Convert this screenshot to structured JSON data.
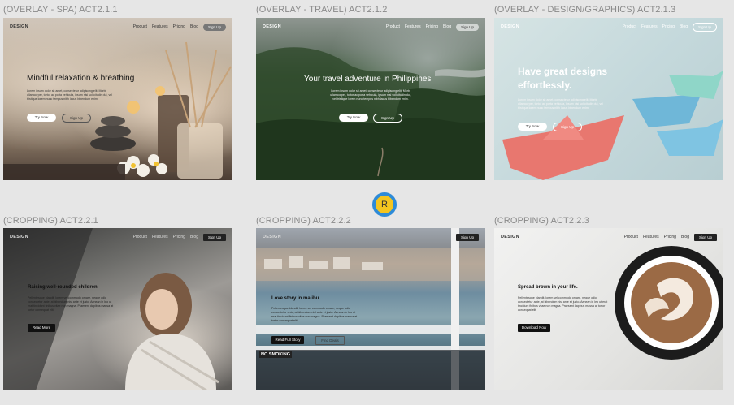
{
  "frames": [
    {
      "label": "(OVERLAY - SPA) ACT2.1.1",
      "logo": "DESIGN",
      "nav": [
        "Product",
        "Features",
        "Pricing",
        "Blog"
      ],
      "nav_button": "Sign Up",
      "title": "Mindful relaxation & breathing",
      "body": "Lorem ipsum dolor sit amet, consectetur adipiscing elit. Morbi ullamcorper, tortor ac porta vehicula, ipsum nisi sollicitudin dui, vel tristique lorem nunc tempus nibh lacus bibendum enim.",
      "primary_button": "Try Now",
      "secondary_button": "Sign Up"
    },
    {
      "label": "(OVERLAY - TRAVEL) ACT2.1.2",
      "logo": "DESIGN",
      "nav": [
        "Product",
        "Features",
        "Pricing",
        "Blog"
      ],
      "nav_button": "Sign Up",
      "title": "Your travel adventure in Philippines",
      "body": "Lorem ipsum dolor sit amet, consectetur adipiscing elit. Morbi ullamcorper, tortor ac porta vehicula, ipsum nisi sollicitudin dui, vel tristique lorem nunc tempus nibh lacus bibendum enim.",
      "primary_button": "Try Now",
      "secondary_button": "Sign Up"
    },
    {
      "label": "(OVERLAY - DESIGN/GRAPHICS) ACT2.1.3",
      "logo": "DESIGN",
      "nav": [
        "Product",
        "Features",
        "Pricing",
        "Blog"
      ],
      "nav_button": "Sign Up",
      "title": "Have great designs effortlessly.",
      "body": "Lorem ipsum dolor sit amet, consectetur adipiscing elit. Morbi ullamcorper, tortor ac porta vehicula, ipsum nisi sollicitudin dui, vel tristique lorem nunc tempus nibh lacus bibendum enim.",
      "primary_button": "Try Now",
      "secondary_button": "Sign Up"
    },
    {
      "label": "(CROPPING) ACT2.2.1",
      "logo": "DESIGN",
      "nav": [
        "Product",
        "Features",
        "Pricing",
        "Blog"
      ],
      "nav_button": "Sign Up",
      "title": "Raising well-rounded children",
      "body": "Pellentesque blandit, lorem vel commodo ornare, neque odio consectetur ante, at bibendum nisl ante et justo. Aenean in leo ut erat tincidunt finibus vitae non magna. Praesent dapibus massa at tortor consequat elit.",
      "primary_button": "Read More"
    },
    {
      "label": "(CROPPING) ACT2.2.2",
      "logo": "DESIGN",
      "nav": [
        "Product",
        "Features",
        "Pricing",
        "Blog"
      ],
      "nav_button": "Sign Up",
      "title": "Love story in malibu.",
      "body": "Pellentesque blandit, lorem vel commodo ornare, neque odio consectetur ante, at bibendum nisl ante et justo. Aenean in leo ut erat tincidunt finibus vitae non magna. Praesent dapibus massa at tortor consequat elit.",
      "primary_button": "Read Full Story",
      "secondary_button": "Find Deals",
      "sign_text": "NO SMOKING"
    },
    {
      "label": "(CROPPING) ACT2.2.3",
      "logo": "DESIGN",
      "nav": [
        "Product",
        "Features",
        "Pricing",
        "Blog"
      ],
      "nav_button": "Sign Up",
      "title": "Spread brown in your life.",
      "body": "Pellentesque blandit, lorem vel commodo ornare, neque odio consectetur ante, at bibendum nisl ante et justo. Aenean in leo ut erat tincidunt finibus vitae non magna. Praesent dapibus massa at tortor consequat elit.",
      "primary_button": "Download Now"
    }
  ],
  "badge": {
    "letter": "R",
    "color": "#f4c51f",
    "ring": "#2e8bd8"
  }
}
